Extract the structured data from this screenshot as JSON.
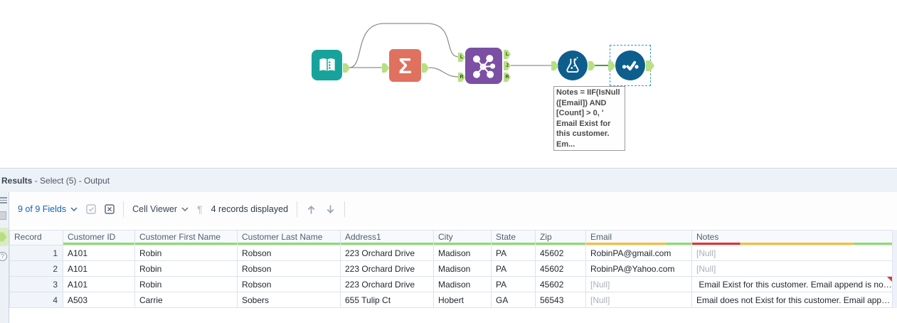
{
  "canvas": {
    "annotation_text": "Notes = IIF(IsNull\n([Email]) AND\n[Count] > 0, '\nEmail Exist for\nthis customer.\nEm...",
    "summarize_glyph": "Σ",
    "join_inputs": [
      "L",
      "R"
    ],
    "join_outputs": [
      "L",
      "J",
      "R"
    ],
    "colors": {
      "input_tool": "#17a39b",
      "summarize_tool": "#e0715f",
      "join_tool": "#7b4fa3",
      "formula_tool": "#0d5e8d",
      "select_tool": "#0d5e8d",
      "anchor_green": "#b7e084",
      "connection_gray": "#909090",
      "connection_selected": "#3fa142",
      "selection_border": "#2e9bd6"
    }
  },
  "results": {
    "title": {
      "panel": "Results",
      "suffix": " - Select (5) - Output"
    },
    "toolbar": {
      "fields": "9 of 9 Fields",
      "cell_viewer": "Cell Viewer",
      "records": "4 records displayed"
    },
    "table": {
      "columns": [
        {
          "label": "Record",
          "quality": []
        },
        {
          "label": "Customer ID",
          "quality": [
            {
              "c": "#8fdb71",
              "f": 1
            }
          ]
        },
        {
          "label": "Customer First Name",
          "quality": [
            {
              "c": "#8fdb71",
              "f": 1
            }
          ]
        },
        {
          "label": "Customer Last Name",
          "quality": [
            {
              "c": "#8fdb71",
              "f": 1
            }
          ]
        },
        {
          "label": "Address1",
          "quality": [
            {
              "c": "#8fdb71",
              "f": 1
            }
          ]
        },
        {
          "label": "City",
          "quality": [
            {
              "c": "#8fdb71",
              "f": 1
            }
          ]
        },
        {
          "label": "State",
          "quality": [
            {
              "c": "#8fdb71",
              "f": 1
            }
          ]
        },
        {
          "label": "Zip",
          "quality": [
            {
              "c": "#8fdb71",
              "f": 1
            }
          ]
        },
        {
          "label": "Email",
          "quality": [
            {
              "c": "#f2c13e",
              "f": 0.76
            },
            {
              "c": "#8fdb71",
              "f": 0.24
            }
          ]
        },
        {
          "label": "Notes",
          "quality": [
            {
              "c": "#e2342e",
              "f": 0.24
            },
            {
              "c": "#f2c13e",
              "f": 0.57
            },
            {
              "c": "#8fdb71",
              "f": 0.19
            }
          ]
        }
      ],
      "rows": [
        [
          "1",
          "A101",
          "Robin",
          "Robson",
          "223 Orchard Drive",
          "Madison",
          "PA",
          "45602",
          "RobinPA@gmail.com",
          "[Null]"
        ],
        [
          "2",
          "A101",
          "Robin",
          "Robson",
          "223 Orchard Drive",
          "Madison",
          "PA",
          "45602",
          "RobinPA@Yahoo.com",
          "[Null]"
        ],
        [
          "3",
          "A101",
          "Robin",
          "Robson",
          "223 Orchard Drive",
          "Madison",
          "PA",
          "45602",
          "[Null]",
          " Email Exist for this customer. Email append is no…"
        ],
        [
          "4",
          "A503",
          "Carrie",
          "Sobers",
          "655 Tulip Ct",
          "Hobert",
          "GA",
          "56543",
          "[Null]",
          "Email does not Exist for this customer. Email app…"
        ]
      ]
    }
  }
}
